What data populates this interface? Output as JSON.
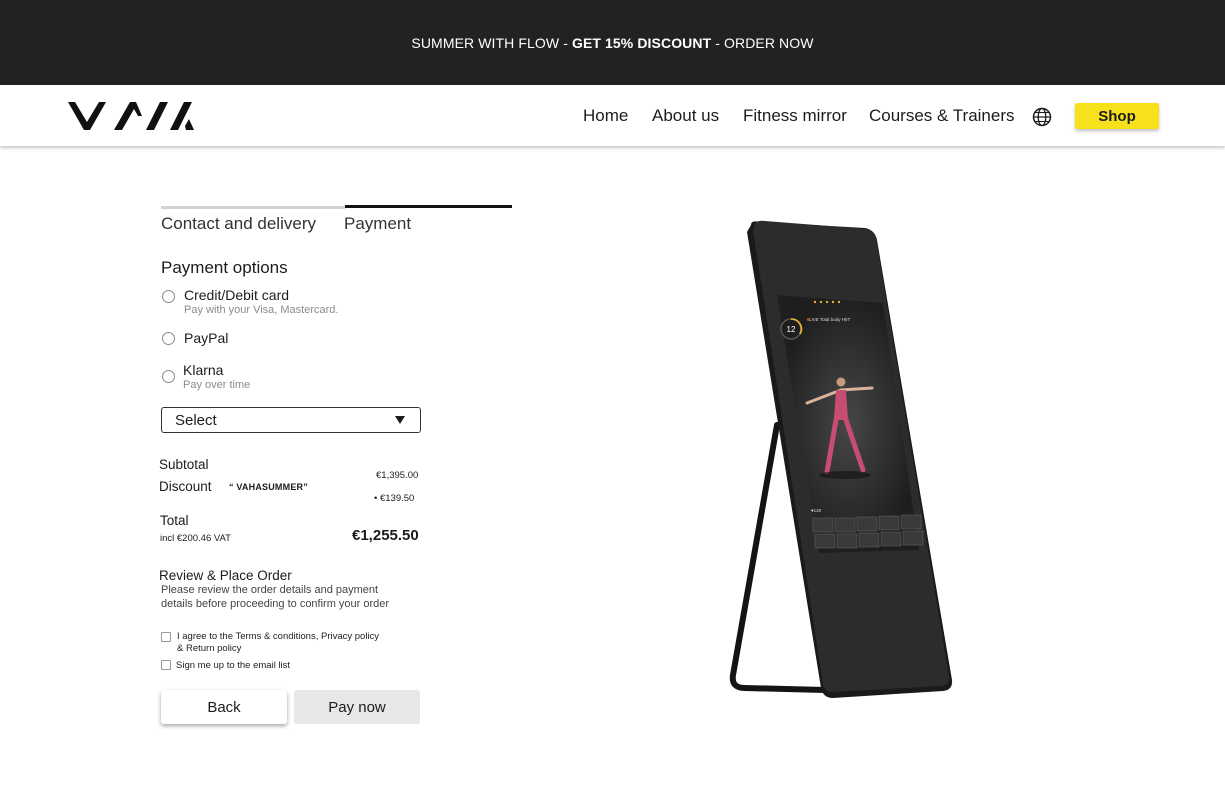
{
  "promo": {
    "part1": "SUMMER WITH FLOW - ",
    "bold": "GET 15% DISCOUNT",
    "part2": " - ORDER NOW"
  },
  "header": {
    "logo": "VAHA",
    "nav": [
      "Home",
      "About us",
      "Fitness mirror",
      "Courses & Trainers"
    ],
    "shop": "Shop"
  },
  "steps": {
    "contact": "Contact and delivery",
    "payment": "Payment"
  },
  "payment": {
    "title": "Payment options",
    "options": [
      {
        "label": "Credit/Debit card",
        "sub": "Pay with your Visa, Mastercard."
      },
      {
        "label": "PayPal",
        "sub": ""
      },
      {
        "label": "Klarna",
        "sub": "Pay over time"
      }
    ],
    "select": "Select"
  },
  "summary": {
    "subtotal_label": "Subtotal",
    "subtotal_value": "€1,395.00",
    "discount_label": "Discount",
    "discount_code": "“ VAHASUMMER”",
    "discount_value": "• €139.50",
    "total_label": "Total",
    "vat": "incl €200.46 VAT",
    "total_value": "€1,255.50"
  },
  "review": {
    "title": "Review & Place Order",
    "text": "Please review the order details and payment details before proceeding to confirm your order",
    "agree_line1": "I agree to the Terms & conditions, Privacy policy",
    "agree_line2": "& Return policy",
    "newsletter": "Sign me up to the email list"
  },
  "buttons": {
    "back": "Back",
    "pay": "Pay now"
  },
  "mirror_screen": {
    "timer": "12",
    "live": "LIVE Total body HIIT"
  },
  "colors": {
    "promo_bg": "#222222",
    "shop_yellow": "#f7e11b",
    "pay_grey": "#e7e7e7"
  }
}
